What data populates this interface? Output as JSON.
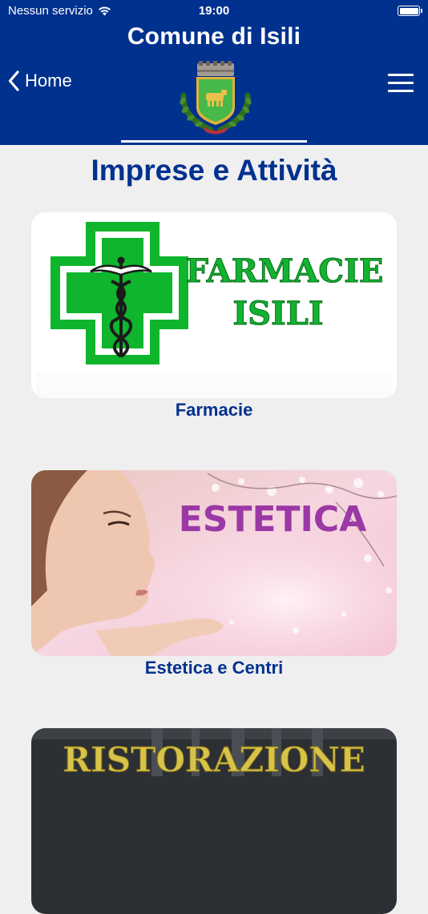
{
  "status_bar": {
    "carrier": "Nessun servizio",
    "time": "19:00"
  },
  "header": {
    "title": "Comune di Isili",
    "back_label": "Home",
    "menu_icon": "hamburger-menu-icon",
    "back_icon": "chevron-left-icon",
    "background_color": "#00318f"
  },
  "page": {
    "title": "Imprese e Attività"
  },
  "cards": [
    {
      "label": "Farmacie",
      "image_text_line1": "FARMACIE",
      "image_text_line2": "ISILI"
    },
    {
      "label": "Estetica e Centri",
      "image_text": "ESTETICA"
    },
    {
      "image_text": "RISTORAZIONE"
    }
  ]
}
